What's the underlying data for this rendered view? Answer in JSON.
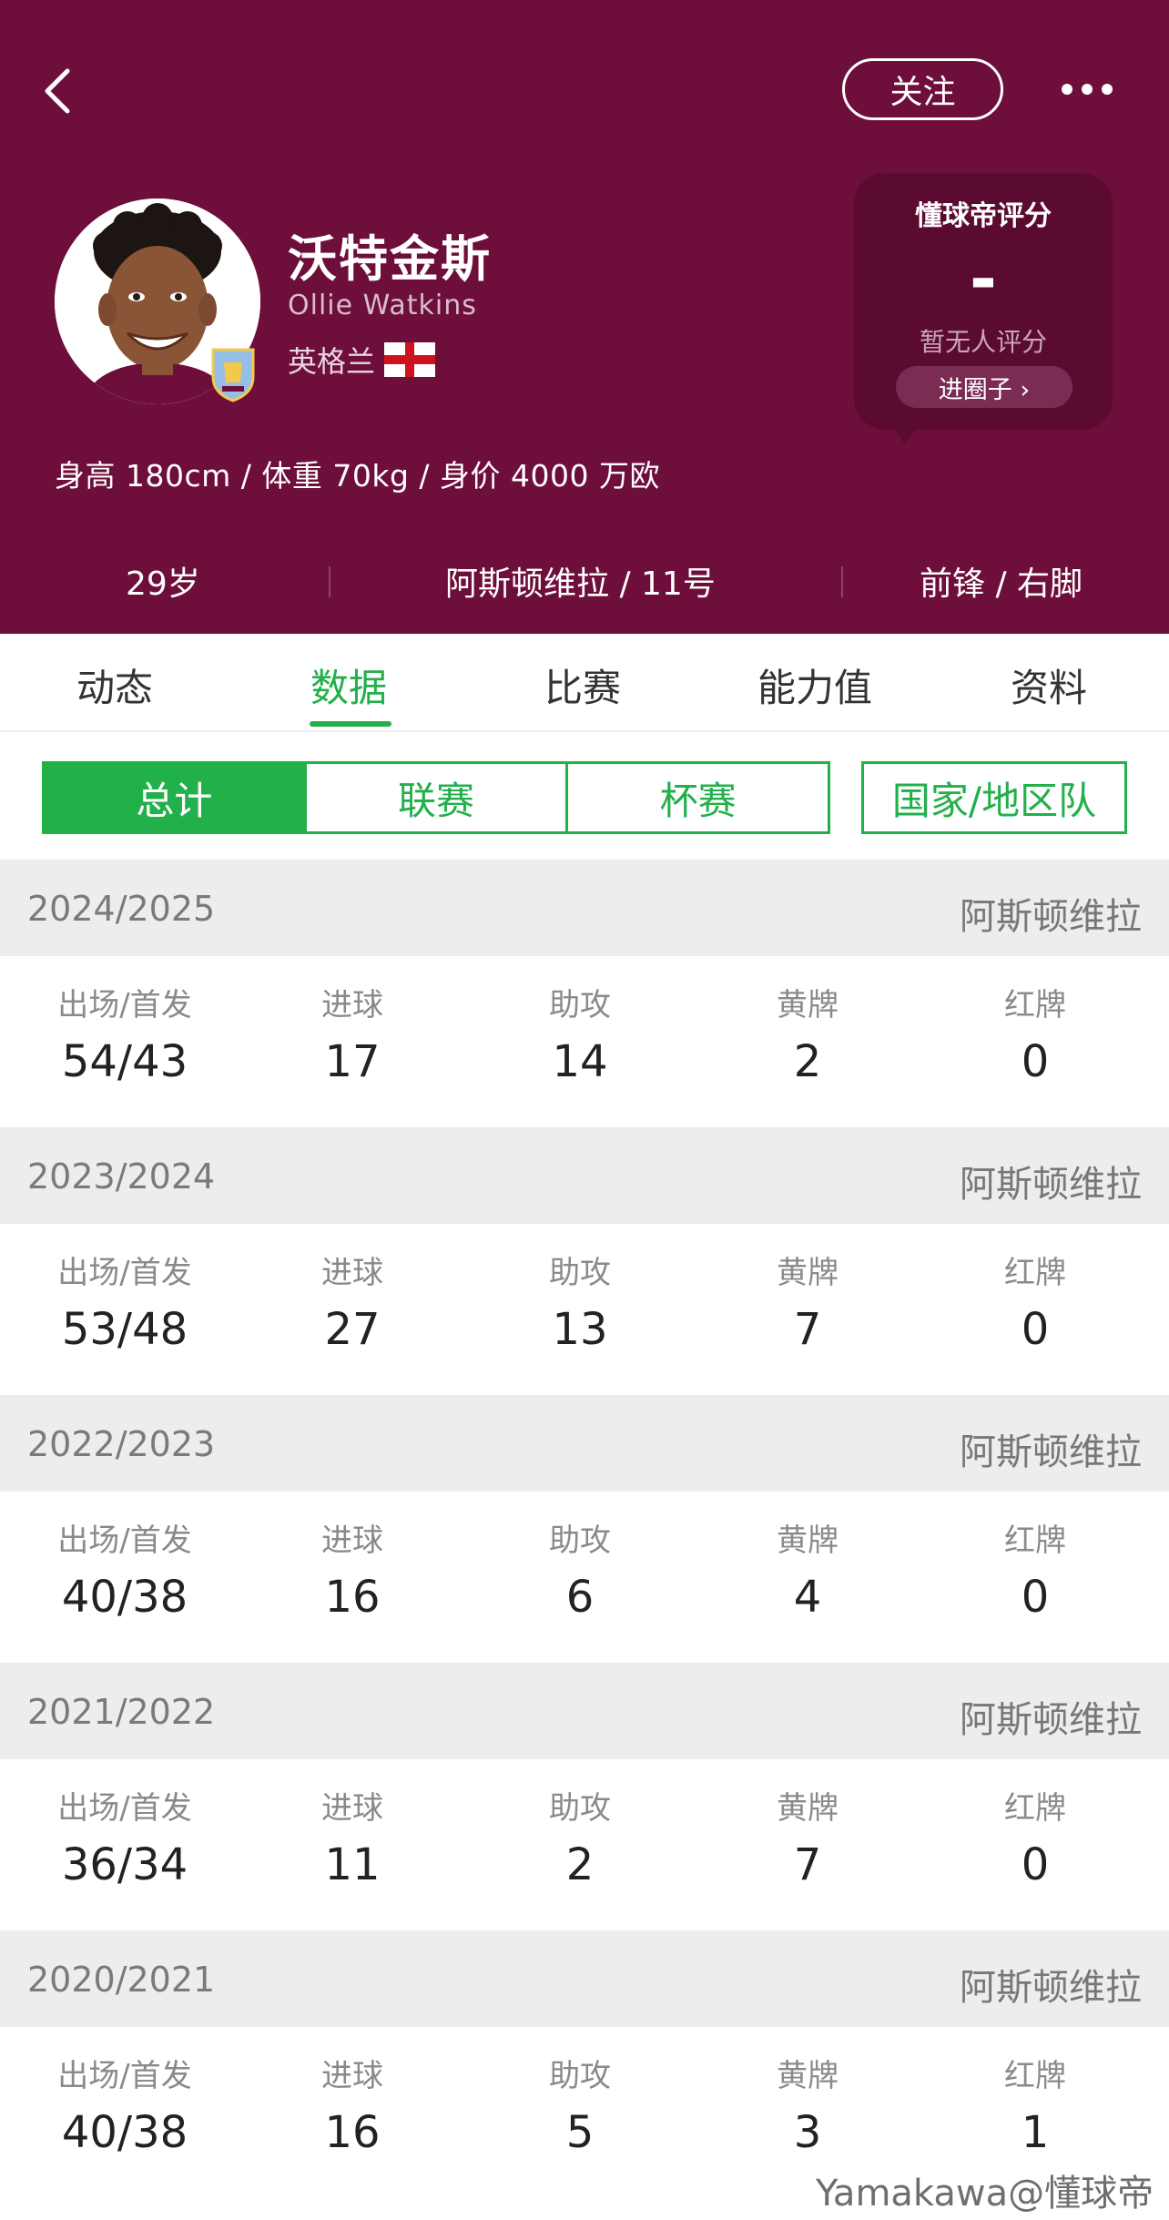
{
  "header": {
    "follow_label": "关注",
    "player": {
      "name_cn": "沃特金斯",
      "name_en": "Ollie Watkins",
      "nation": "英格兰",
      "body_stats": "身高 180cm / 体重 70kg / 身价 4000 万欧"
    },
    "rating": {
      "title": "懂球帝评分",
      "value": "-",
      "note": "暂无人评分",
      "circle_label": "进圈子 ›"
    },
    "info": {
      "age": "29岁",
      "club_number": "阿斯顿维拉 / 11号",
      "position_foot": "前锋 / 右脚"
    }
  },
  "tabs": [
    "动态",
    "数据",
    "比赛",
    "能力值",
    "资料"
  ],
  "active_tab": "数据",
  "filters": {
    "segments": [
      "总计",
      "联赛",
      "杯赛"
    ],
    "active": "总计",
    "nation_team": "国家/地区队"
  },
  "stat_labels": [
    "出场/首发",
    "进球",
    "助攻",
    "黄牌",
    "红牌"
  ],
  "seasons": [
    {
      "year": "2024/2025",
      "club": "阿斯顿维拉",
      "values": [
        "54/43",
        "17",
        "14",
        "2",
        "0"
      ]
    },
    {
      "year": "2023/2024",
      "club": "阿斯顿维拉",
      "values": [
        "53/48",
        "27",
        "13",
        "7",
        "0"
      ]
    },
    {
      "year": "2022/2023",
      "club": "阿斯顿维拉",
      "values": [
        "40/38",
        "16",
        "6",
        "4",
        "0"
      ]
    },
    {
      "year": "2021/2022",
      "club": "阿斯顿维拉",
      "values": [
        "36/34",
        "11",
        "2",
        "7",
        "0"
      ]
    },
    {
      "year": "2020/2021",
      "club": "阿斯顿维拉",
      "values": [
        "40/38",
        "16",
        "5",
        "3",
        "1"
      ]
    }
  ],
  "watermark": "Yamakawa@懂球帝",
  "colors": {
    "header_bg": "#6e0e3a",
    "accent_green": "#22b04b",
    "season_header_bg": "#ededee"
  }
}
